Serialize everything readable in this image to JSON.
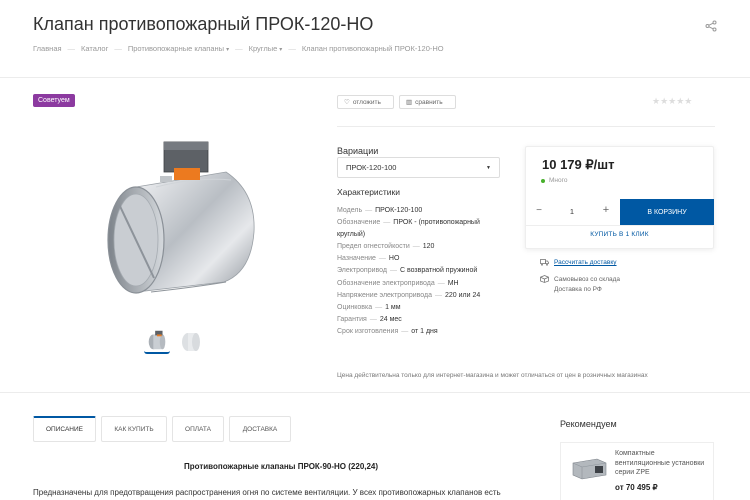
{
  "header": {
    "title": "Клапан противопожарный ПРОК-120-НО",
    "breadcrumbs": [
      "Главная",
      "Каталог",
      "Противопожарные клапаны",
      "Круглые",
      "Клапан противопожарный ПРОК-120-НО"
    ],
    "breadcrumb_sep": "—"
  },
  "badge": "Советуем",
  "actions": {
    "defer": "отложить",
    "compare": "сравнить"
  },
  "rating": {
    "stars": "★★★★★",
    "value": 0
  },
  "variations": {
    "title": "Вариации",
    "selected": "ПРОК-120-100"
  },
  "characteristics": {
    "title": "Характеристики",
    "items": [
      {
        "k": "Модель",
        "v": "ПРОК-120-100"
      },
      {
        "k": "Обозначение",
        "v": "ПРОК - (противопожарный круглый)"
      },
      {
        "k": "Предел огнестойкости",
        "v": "120"
      },
      {
        "k": "Назначение",
        "v": "НО"
      },
      {
        "k": "Электропривод",
        "v": "С возвратной пружиной"
      },
      {
        "k": "Обозначение электропривода",
        "v": "МН"
      },
      {
        "k": "Напряжение электропривода",
        "v": "220 или 24"
      },
      {
        "k": "Оцинковка",
        "v": "1 мм"
      },
      {
        "k": "Гарантия",
        "v": "24 мес"
      },
      {
        "k": "Срок изготовления",
        "v": "от 1 дня"
      }
    ]
  },
  "price_note": "Цена действительна только для интернет-магазина и может отличаться от цен в розничных магазинах",
  "buy": {
    "price": "10 179 ₽/шт",
    "stock": "Много",
    "qty_minus": "−",
    "qty": "1",
    "qty_plus": "+",
    "cart": "В корзину",
    "oneclick": "Купить в 1 клик",
    "delivery_link": "Рассчитать доставку",
    "pickup_line1": "Самовывоз со склада",
    "pickup_line2": "Доставка по РФ"
  },
  "tabs": [
    "Описание",
    "Как купить",
    "Оплата",
    "Доставка"
  ],
  "description": {
    "heading": "Противопожарные клапаны ПРОК-90-НО (220,24)",
    "text": "Предназначены для предотвращения распространения огня по системе вентиляции. У всех противопожарных клапанов есть"
  },
  "recommended": {
    "title": "Рекомендуем",
    "name": "Компактные вентиляционные установки серии ZPE",
    "price": "от 70 495 ₽"
  },
  "colors": {
    "accent": "#0058a3",
    "badge": "#8c3aa0",
    "stock": "#48b02c"
  }
}
